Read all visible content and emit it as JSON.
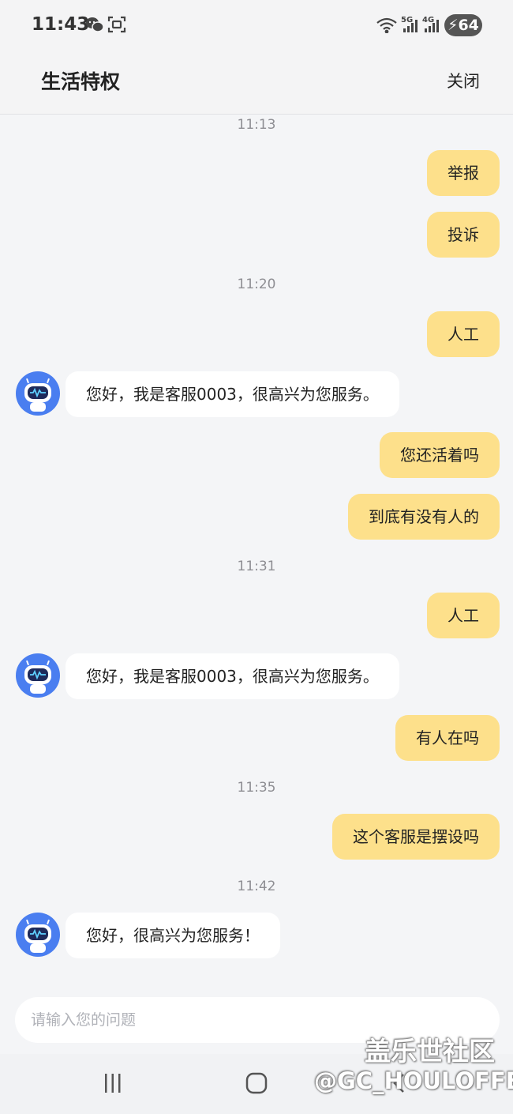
{
  "status_bar": {
    "time": "11:43",
    "net_5g": "5G",
    "net_4g": "4G",
    "battery": "64"
  },
  "header": {
    "title": "生活特权",
    "close_label": "关闭"
  },
  "messages": [
    {
      "type": "time",
      "text": "11:13"
    },
    {
      "type": "out",
      "text": "举报"
    },
    {
      "type": "out",
      "text": "投诉"
    },
    {
      "type": "time",
      "text": "11:20"
    },
    {
      "type": "out",
      "text": "人工"
    },
    {
      "type": "in",
      "text": "您好，我是客服0003，很高兴为您服务。"
    },
    {
      "type": "out",
      "text": "您还活着吗"
    },
    {
      "type": "out",
      "text": "到底有没有人的"
    },
    {
      "type": "time",
      "text": "11:31"
    },
    {
      "type": "out",
      "text": "人工"
    },
    {
      "type": "in",
      "text": "您好，我是客服0003，很高兴为您服务。"
    },
    {
      "type": "out",
      "text": "有人在吗"
    },
    {
      "type": "time",
      "text": "11:35"
    },
    {
      "type": "out",
      "text": "这个客服是摆设吗"
    },
    {
      "type": "time",
      "text": "11:42"
    },
    {
      "type": "in",
      "text": "您好，很高兴为您服务！"
    }
  ],
  "input": {
    "value": "",
    "placeholder": "请输入您的问题"
  },
  "watermark": {
    "line1": "盖乐世社区",
    "line2": "@GC_HOULOFFE"
  },
  "colors": {
    "outgoing_bubble": "#fde08b",
    "incoming_bubble": "#ffffff",
    "background": "#f4f5f7",
    "avatar": "#4a7ef0"
  }
}
